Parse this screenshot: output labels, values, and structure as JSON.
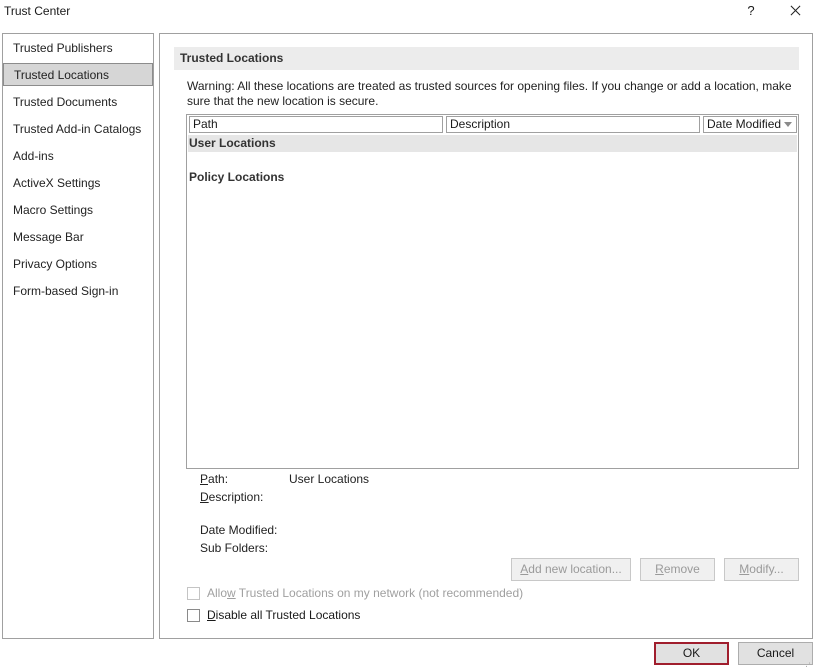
{
  "window": {
    "title": "Trust Center",
    "help_label": "?"
  },
  "nav": {
    "items": [
      {
        "label": "Trusted Publishers"
      },
      {
        "label": "Trusted Locations",
        "selected": true
      },
      {
        "label": "Trusted Documents"
      },
      {
        "label": "Trusted Add-in Catalogs"
      },
      {
        "label": "Add-ins"
      },
      {
        "label": "ActiveX Settings"
      },
      {
        "label": "Macro Settings"
      },
      {
        "label": "Message Bar"
      },
      {
        "label": "Privacy Options"
      },
      {
        "label": "Form-based Sign-in"
      }
    ]
  },
  "content": {
    "section_title": "Trusted Locations",
    "warning": "Warning: All these locations are treated as trusted sources for opening files.  If you change or add a location, make sure that the new location is secure.",
    "table": {
      "columns": [
        "Path",
        "Description",
        "Date Modified"
      ],
      "groups": [
        "User Locations",
        "Policy Locations"
      ]
    },
    "details": {
      "path_label": "Path:",
      "path_value": "User Locations",
      "description_label": "Description:",
      "date_modified_label": "Date Modified:",
      "sub_folders_label": "Sub Folders:"
    },
    "buttons": {
      "add": "Add new location...",
      "remove": "Remove",
      "modify": "Modify..."
    },
    "checkboxes": {
      "allow_network": "Allow Trusted Locations on my network (not recommended)",
      "disable_all": "Disable all Trusted Locations"
    }
  },
  "footer": {
    "ok": "OK",
    "cancel": "Cancel"
  },
  "colors": {
    "selected_nav_bg": "#d6d6d6",
    "section_header_bg": "#ececec",
    "ok_border": "#a01e2d"
  }
}
